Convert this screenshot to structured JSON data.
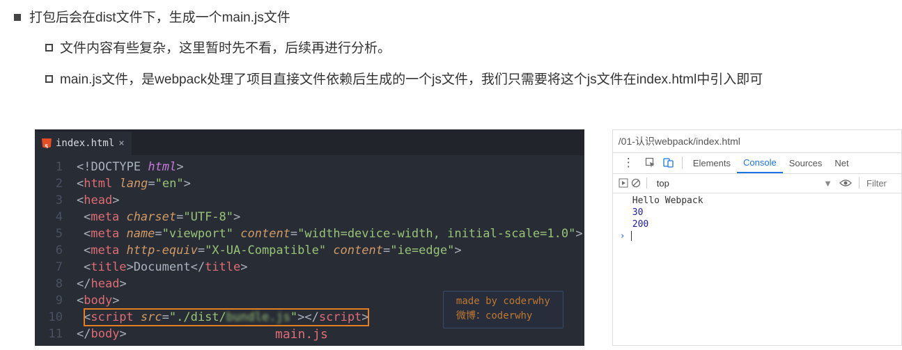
{
  "bullets": {
    "l1": "打包后会在dist文件下，生成一个main.js文件",
    "l2a": "文件内容有些复杂，这里暂时先不看，后续再进行分析。",
    "l2b": "main.js文件，是webpack处理了项目直接文件依赖后生成的一个js文件，我们只需要将这个js文件在index.html中引入即可"
  },
  "editor": {
    "tab_name": "index.html",
    "line_numbers": [
      "1",
      "2",
      "3",
      "4",
      "5",
      "6",
      "7",
      "8",
      "9",
      "10",
      "11"
    ],
    "code": {
      "l1": {
        "punc0": "<!",
        "doctype": "DOCTYPE",
        "sp": " ",
        "html_kw": "html",
        "punc1": ">"
      },
      "l2": {
        "o": "<",
        "tag": "html",
        "sp": " ",
        "attr": "lang",
        "eq": "=",
        "val": "\"en\"",
        "c": ">"
      },
      "l3": {
        "o": "<",
        "tag": "head",
        "c": ">"
      },
      "l4": {
        "o": "<",
        "tag": "meta",
        "sp": " ",
        "attr": "charset",
        "eq": "=",
        "val": "\"UTF-8\"",
        "c": ">"
      },
      "l5": {
        "o": "<",
        "tag": "meta",
        "sp": " ",
        "a1": "name",
        "eq1": "=",
        "v1": "\"viewport\"",
        "sp2": " ",
        "a2": "content",
        "eq2": "=",
        "v2": "\"width=device-width, initial-scale=1.0\"",
        "c": ">"
      },
      "l6": {
        "o": "<",
        "tag": "meta",
        "sp": " ",
        "a1": "http-equiv",
        "eq1": "=",
        "v1": "\"X-UA-Compatible\"",
        "sp2": " ",
        "a2": "content",
        "eq2": "=",
        "v2": "\"ie=edge\"",
        "c": ">"
      },
      "l7": {
        "o": "<",
        "tag": "title",
        "c": ">",
        "text": "Document",
        "o2": "</",
        "tag2": "title",
        "c2": ">"
      },
      "l8": {
        "o": "</",
        "tag": "head",
        "c": ">"
      },
      "l9": {
        "o": "<",
        "tag": "body",
        "c": ">"
      },
      "l10": {
        "o": "<",
        "tag": "script",
        "sp": " ",
        "attr": "src",
        "eq": "=",
        "val_pre": "\"./dist/",
        "val_blur": "bundle.js",
        "val_post": "\"",
        "c": "></",
        "tag2": "script",
        "c2": ">"
      },
      "l11": {
        "o": "</",
        "tag": "body",
        "c": ">"
      }
    },
    "mainjs_label": "main.js",
    "watermark": {
      "line1": "made by coderwhy",
      "line2": "微博：coderwhy"
    }
  },
  "devtools": {
    "url": "/01-认识webpack/index.html",
    "tabs": {
      "elements": "Elements",
      "console": "Console",
      "sources": "Sources",
      "network": "Net"
    },
    "context": "top",
    "filter_placeholder": "Filter",
    "console_output": {
      "line1": "Hello Webpack",
      "line2": "30",
      "line3": "200"
    }
  }
}
